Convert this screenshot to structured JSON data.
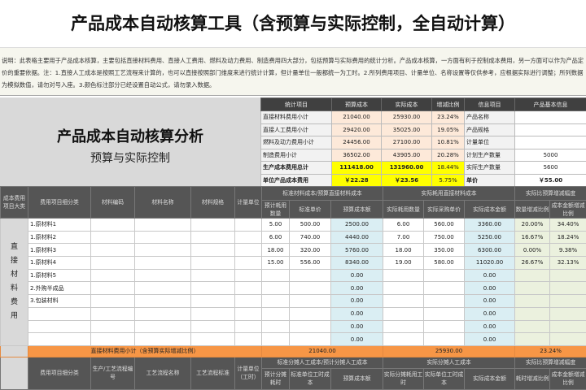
{
  "title": "产品成本自动核算工具（含预算与实际控制，全自动计算）",
  "description": "说明：此表格主要用于产品成本核算，主要包括直接材料费用、直接人工费用、燃料及动力费用、制造费用四大部分，包括预算与实际费用的统计分析。产品成本核算，一方面有利于控制成本费用，另一方面可以作为产品定价的重要依据。注：1.直接人工成本是按照工艺流程来计算的，也可以直接按照部门维度来进行统计计算，但计量单位一般都统一为工时。2.所列费用项目、计量单位、名称设置等仅供参考，应根据实际进行调整；所列数据为模拟数值，请勿对号入座。3.颜色标注部分已经设置自动公式，请勿录入数据。",
  "left_block": {
    "title": "产品成本自动核算分析",
    "subtitle": "预算与实际控制"
  },
  "summary": {
    "headers": [
      "统计项目",
      "预算成本",
      "实际成本",
      "增减比例",
      "信息项目",
      "产品基本信息"
    ],
    "rows": [
      {
        "item": "直接材料费用小计",
        "budget": "21040.00",
        "actual": "25930.00",
        "ratio": "23.24%",
        "info": "产品名称",
        "value": ""
      },
      {
        "item": "直接人工费用小计",
        "budget": "29420.00",
        "actual": "35025.00",
        "ratio": "19.05%",
        "info": "产品规格",
        "value": ""
      },
      {
        "item": "燃料及动力费用小计",
        "budget": "24456.00",
        "actual": "27100.00",
        "ratio": "10.81%",
        "info": "计量单位",
        "value": ""
      },
      {
        "item": "制造费用小计",
        "budget": "36502.00",
        "actual": "43905.00",
        "ratio": "20.28%",
        "info": "计划生产数量",
        "value": "5000"
      },
      {
        "item": "生产成本费用总计",
        "budget": "111418.00",
        "actual": "131960.00",
        "ratio": "18.44%",
        "info": "实际生产数量",
        "value": "5600"
      },
      {
        "item": "单位产品成本费用",
        "budget": "￥22.28",
        "actual": "￥23.56",
        "ratio": "5.75%",
        "info": "单价",
        "value": "￥55.00"
      }
    ]
  },
  "materials": {
    "headers": {
      "category": "成本费用项目大类",
      "sub": "费用项目细分类",
      "code": "材料编码",
      "name": "材料名称",
      "spec": "材料规格",
      "unit": "计量单位",
      "std_group": "标准材料成本/预算直接材料成本",
      "act_group": "实际耗用直接材料成本",
      "cmp_group": "实际比预算增减幅度",
      "qty": "预计耗用数量",
      "price": "标准单价",
      "budget": "预算成本额",
      "aqty": "实际耗用数量",
      "aprice": "实际采购单价",
      "aamount": "实际成本金额",
      "qratio": "数量增减比例",
      "aratio": "成本金额增减比例"
    },
    "category": "直接材料费用",
    "rows": [
      {
        "sub": "1.原材料1",
        "qty": "5.00",
        "price": "500.00",
        "budget": "2500.00",
        "aqty": "6.00",
        "aprice": "560.00",
        "aamount": "3360.00",
        "qratio": "20.00%",
        "aratio": "34.40%"
      },
      {
        "sub": "1.原材料2",
        "qty": "6.00",
        "price": "740.00",
        "budget": "4440.00",
        "aqty": "7.00",
        "aprice": "750.00",
        "aamount": "5250.00",
        "qratio": "16.67%",
        "aratio": "18.24%"
      },
      {
        "sub": "1.原材料3",
        "qty": "18.00",
        "price": "320.00",
        "budget": "5760.00",
        "aqty": "18.00",
        "aprice": "350.00",
        "aamount": "6300.00",
        "qratio": "0.00%",
        "aratio": "9.38%"
      },
      {
        "sub": "1.原材料4",
        "qty": "15.00",
        "price": "556.00",
        "budget": "8340.00",
        "aqty": "19.00",
        "aprice": "580.00",
        "aamount": "11020.00",
        "qratio": "26.67%",
        "aratio": "32.13%"
      },
      {
        "sub": "1.原材料5",
        "qty": "",
        "price": "",
        "budget": "0.00",
        "aqty": "",
        "aprice": "",
        "aamount": "0.00",
        "qratio": "",
        "aratio": ""
      },
      {
        "sub": "2.外购半成品",
        "qty": "",
        "price": "",
        "budget": "0.00",
        "aqty": "",
        "aprice": "",
        "aamount": "0.00",
        "qratio": "",
        "aratio": ""
      },
      {
        "sub": "3.包装材料",
        "qty": "",
        "price": "",
        "budget": "0.00",
        "aqty": "",
        "aprice": "",
        "aamount": "0.00",
        "qratio": "",
        "aratio": ""
      },
      {
        "sub": "",
        "qty": "",
        "price": "",
        "budget": "0.00",
        "aqty": "",
        "aprice": "",
        "aamount": "0.00",
        "qratio": "",
        "aratio": ""
      },
      {
        "sub": "",
        "qty": "",
        "price": "",
        "budget": "0.00",
        "aqty": "",
        "aprice": "",
        "aamount": "0.00",
        "qratio": "",
        "aratio": ""
      },
      {
        "sub": "",
        "qty": "",
        "price": "",
        "budget": "0.00",
        "aqty": "",
        "aprice": "",
        "aamount": "0.00",
        "qratio": "",
        "aratio": ""
      }
    ],
    "subtotal": {
      "label": "直接材料费用小计（含预算实际增减比例）",
      "budget": "21040.00",
      "actual": "25930.00",
      "ratio": "23.24%"
    }
  },
  "labor": {
    "headers": {
      "sub": "费用项目细分类",
      "code": "生产/工艺流程编号",
      "name": "工艺流程名称",
      "std": "工艺流程标准",
      "unit": "计量单位（工时）",
      "std_group": "标准分摊人工成本/预计分摊人工成本",
      "act_group": "实际分摊人工成本",
      "cmp_group": "实际比预算增减幅度",
      "hours": "预计分摊耗时",
      "cost": "标准单位工时成本",
      "budget": "预算成本额",
      "ahours": "实际分摊耗用工时",
      "acost": "实际单位工时成本",
      "aamount": "实际成本金额",
      "hratio": "耗时增减比例",
      "aratio": "成本金额增减比例"
    }
  }
}
